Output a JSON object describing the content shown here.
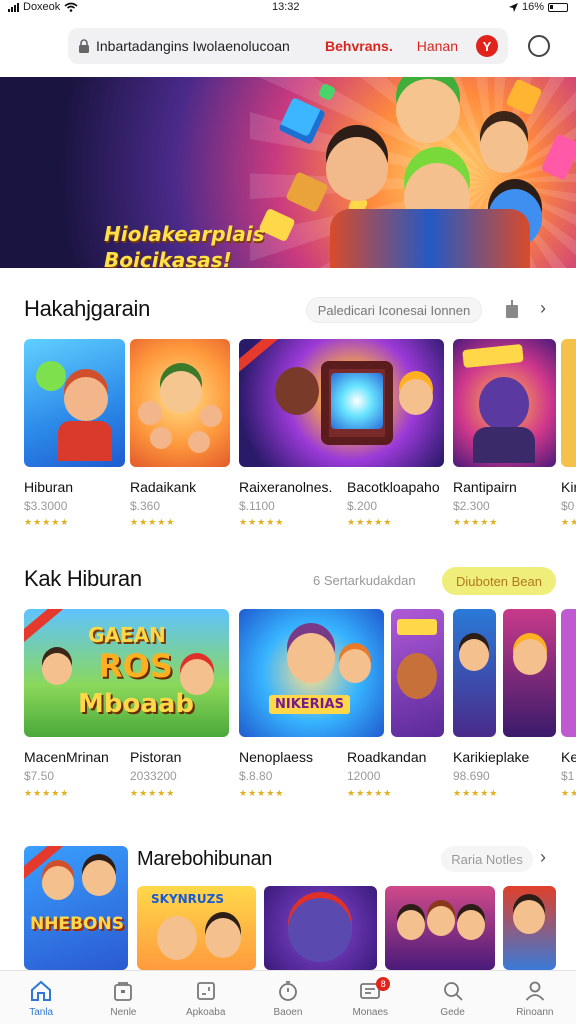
{
  "status_bar": {
    "carrier": "Doxeok",
    "time": "13:32",
    "battery": "16%"
  },
  "browser": {
    "url_text": "Inbartadangins Iwolaenolucoan",
    "highlight_1": "Behvrans.",
    "highlight_2": "Hanan",
    "badge": "Y"
  },
  "banner": {
    "line_1": "Hiolakearplais",
    "line_2": "Boicikasas!"
  },
  "section_1": {
    "title": "Hakahjgarain",
    "search_placeholder": "Paledicari Iconesai Ionnen",
    "items": [
      {
        "name": "Hiburan",
        "price": "$3.3000",
        "rating": "★★★★★"
      },
      {
        "name": "Radaikank",
        "price": "$.360",
        "rating": "★★★★★"
      },
      {
        "name": "Raixeranolnes.",
        "price": "$.1100",
        "rating": "★★★★★"
      },
      {
        "name": "Bacotkloapaho",
        "price": "$.200",
        "rating": "★★★★★"
      },
      {
        "name": "Rantipairn",
        "price": "$2.300",
        "rating": "★★★★★"
      },
      {
        "name": "Kir",
        "price": "$0",
        "rating": "★★"
      }
    ]
  },
  "section_2": {
    "title": "Kak Hiburan",
    "subtitle": "6 Sertarkudakdan",
    "cta": "Diuboten Bean",
    "items": [
      {
        "name": "MacenMrinan",
        "price": "$7.50",
        "rating": "★★★★★",
        "art_line_1": "GAEAN",
        "art_line_2": "ROS",
        "art_line_3": "Mboaab"
      },
      {
        "name": "Pistoran",
        "price": "2033200",
        "rating": "★★★★★"
      },
      {
        "name": "Nenoplaess",
        "price": "$.8.80",
        "rating": "★★★★★",
        "art_line_1": "NIKERIAS"
      },
      {
        "name": "Roadkandan",
        "price": "12000",
        "rating": "★★★★★"
      },
      {
        "name": "Karikieplake",
        "price": "98.690",
        "rating": "★★★★★"
      },
      {
        "name": "Ke",
        "price": "$1",
        "rating": "★★"
      }
    ]
  },
  "section_3": {
    "title": "Marebohibunan",
    "pill": "Raria Notles",
    "art_text": "NHEBONS",
    "art_text_2": "SKYNRUZS"
  },
  "tabbar": [
    {
      "label": "Tanla",
      "icon": "home-icon"
    },
    {
      "label": "Nenle",
      "icon": "store-icon"
    },
    {
      "label": "Apkoaba",
      "icon": "apps-icon"
    },
    {
      "label": "Baoen",
      "icon": "timer-icon"
    },
    {
      "label": "Monaes",
      "icon": "inbox-icon",
      "badge": "8"
    },
    {
      "label": "Gede",
      "icon": "search-icon"
    },
    {
      "label": "Rinoann",
      "icon": "profile-icon"
    }
  ]
}
